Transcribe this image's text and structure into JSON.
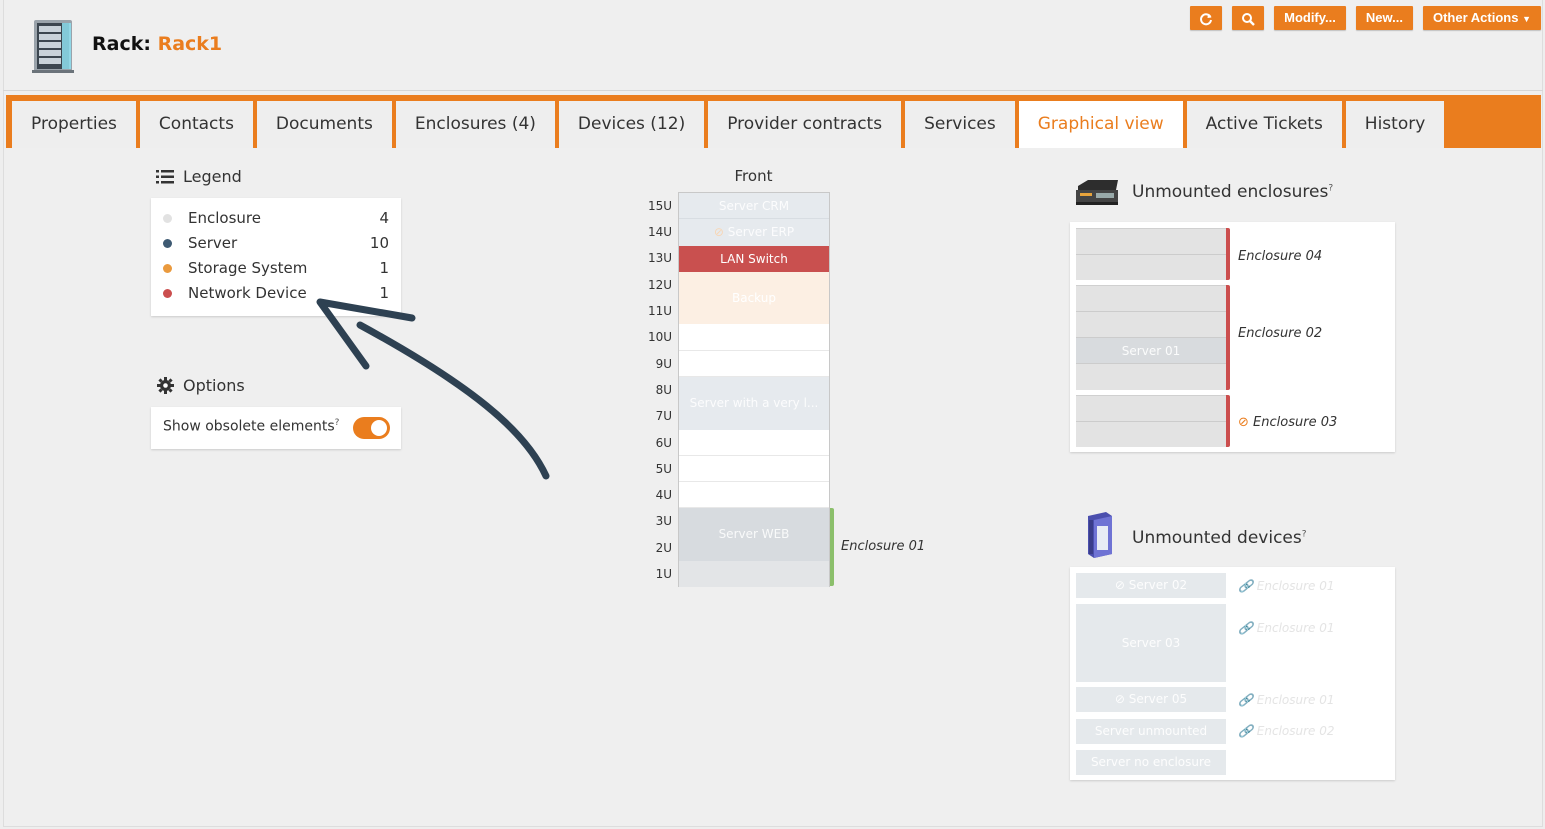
{
  "header": {
    "title_prefix": "Rack: ",
    "title_object": "Rack1",
    "actions": {
      "refresh_icon": "refresh-icon",
      "search_icon": "search-icon",
      "modify": "Modify...",
      "new": "New...",
      "other": "Other Actions"
    }
  },
  "colors": {
    "accent": "#ea7d1e",
    "enclosure": "#e2e2e2",
    "server": "#3e5a73",
    "storage": "#ea9a3e",
    "network": "#cb4e4e",
    "enclosure_bar": "#8bbf6b"
  },
  "tabs": [
    "Properties",
    "Contacts",
    "Documents",
    "Enclosures (4)",
    "Devices (12)",
    "Provider contracts",
    "Services",
    "Graphical view",
    "Active Tickets",
    "History"
  ],
  "active_tab": "Graphical view",
  "legend": {
    "title": "Legend",
    "items": [
      {
        "label": "Enclosure",
        "count": "4"
      },
      {
        "label": "Server",
        "count": "10"
      },
      {
        "label": "Storage System",
        "count": "1"
      },
      {
        "label": "Network Device",
        "count": "1"
      }
    ]
  },
  "options": {
    "title": "Options",
    "show_obsolete": "Show obsolete elements",
    "help": "?",
    "show_obsolete_on": true
  },
  "rack": {
    "front_label": "Front",
    "units": [
      "15U",
      "14U",
      "13U",
      "12U",
      "11U",
      "10U",
      "9U",
      "8U",
      "7U",
      "6U",
      "5U",
      "4U",
      "3U",
      "2U",
      "1U"
    ],
    "devices": {
      "crm": "Server CRM",
      "erp": "Server ERP",
      "lan": "LAN Switch",
      "backup": "Backup",
      "long": "Server with a very l...",
      "web": "Server WEB"
    },
    "enclosure_label": "Enclosure 01"
  },
  "unmounted_enclosures": {
    "title": "Unmounted enclosures",
    "help": "?",
    "enc4": "Enclosure 04",
    "enc2": "Enclosure 02",
    "enc2_device": "Server 01",
    "enc3": "Enclosure 03"
  },
  "unmounted_devices": {
    "title": "Unmounted devices",
    "help": "?",
    "items": [
      {
        "name": "Server 02",
        "link": "Enclosure 01"
      },
      {
        "name": "Server 03",
        "link": "Enclosure 01"
      },
      {
        "name": "Server 05",
        "link": "Enclosure 01"
      },
      {
        "name": "Server unmounted",
        "link": "Enclosure 02"
      },
      {
        "name": "Server no enclosure",
        "link": ""
      }
    ]
  }
}
